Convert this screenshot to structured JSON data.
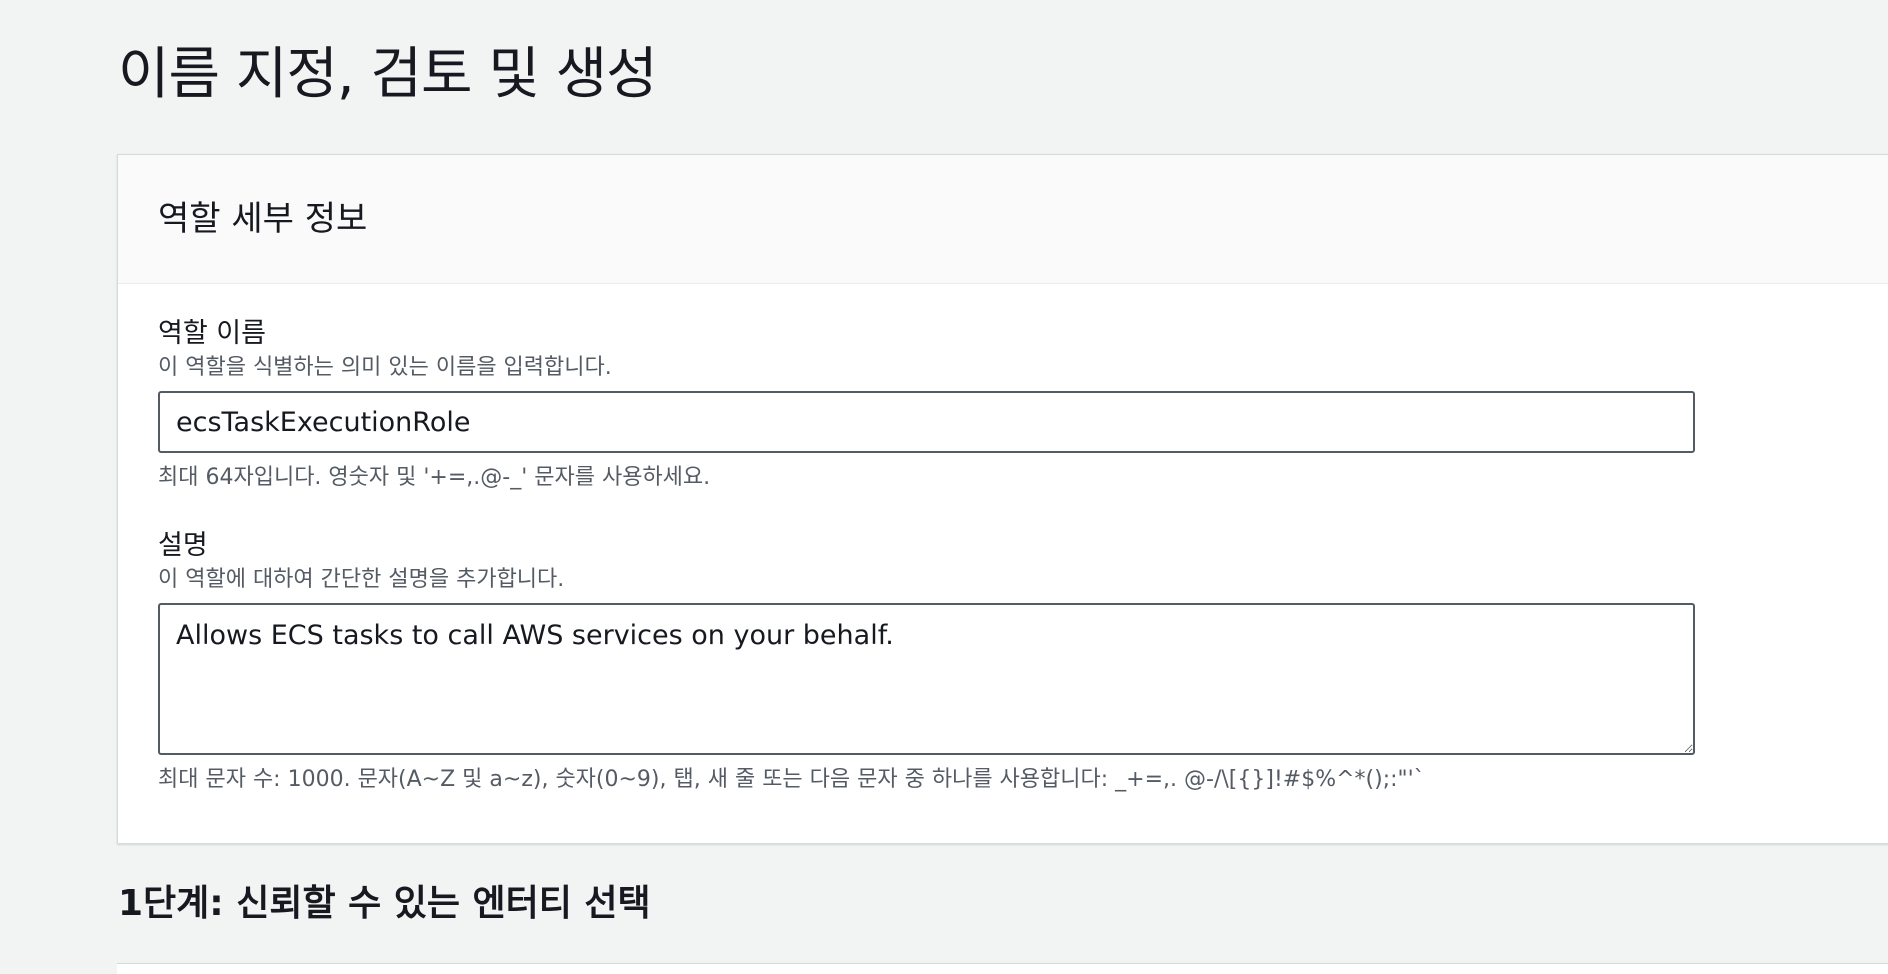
{
  "page": {
    "title": "이름 지정, 검토 및 생성"
  },
  "role_details": {
    "header": "역할 세부 정보",
    "role_name": {
      "label": "역할 이름",
      "description": "이 역할을 식별하는 의미 있는 이름을 입력합니다.",
      "value": "ecsTaskExecutionRole",
      "constraint": "최대 64자입니다. 영숫자 및 '+=,.@-_' 문자를 사용하세요."
    },
    "description": {
      "label": "설명",
      "description": "이 역할에 대하여 간단한 설명을 추가합니다.",
      "value": "Allows ECS tasks to call AWS services on your behalf.",
      "constraint": "최대 문자 수: 1000. 문자(A~Z 및 a~z), 숫자(0~9), 탭, 새 줄 또는 다음 문자 중 하나를 사용합니다: _+=,. @-/\\[{}]!#$%^*();:\"'`"
    }
  },
  "step1": {
    "title": "1단계: 신뢰할 수 있는 엔터티 선택"
  }
}
